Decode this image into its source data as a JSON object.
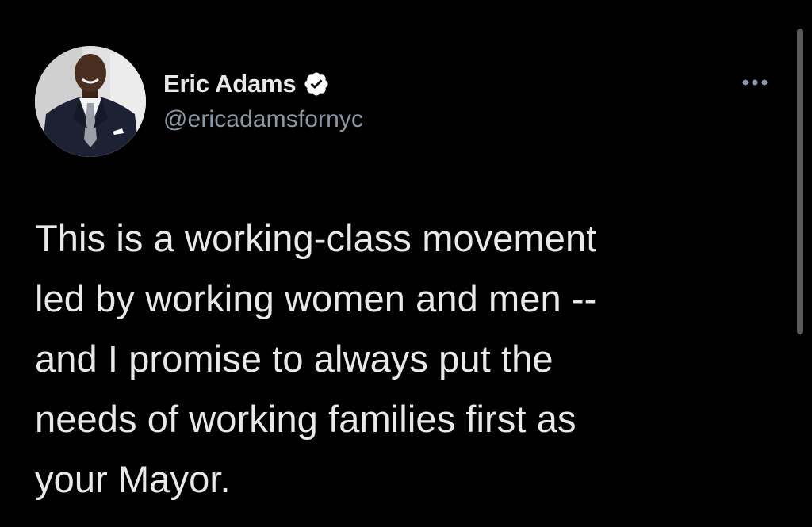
{
  "tweet": {
    "author": {
      "display_name": "Eric Adams",
      "handle": "@ericadamsfornyc",
      "verified": true,
      "avatar_icon": "profile-photo"
    },
    "text": "This is a working-class movement\nled by working women and men --\nand I promise to always put the\nneeds of working families first as\nyour Mayor.",
    "more_icon": "ellipsis-icon"
  },
  "colors": {
    "background": "#000000",
    "text_primary": "#e7e9ea",
    "text_secondary": "#8b98a5",
    "verified_badge": "#ffffff"
  }
}
